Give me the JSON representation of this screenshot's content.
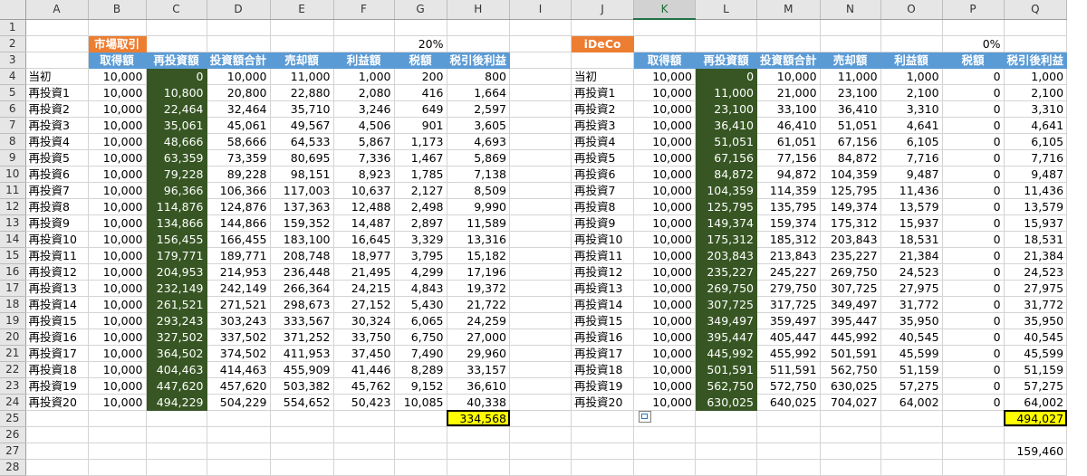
{
  "columns": [
    "A",
    "B",
    "C",
    "D",
    "E",
    "F",
    "G",
    "H",
    "I",
    "J",
    "K",
    "L",
    "M",
    "N",
    "O",
    "P",
    "Q"
  ],
  "selected_column": "K",
  "left": {
    "tag": "市場取引",
    "tax_rate": "20%",
    "headers": [
      "取得額",
      "再投資額",
      "投資額合計",
      "売却額",
      "利益額",
      "税額",
      "税引後利益"
    ],
    "rows": [
      [
        "当初",
        "10,000",
        "0",
        "10,000",
        "11,000",
        "1,000",
        "200",
        "800"
      ],
      [
        "再投資1",
        "10,000",
        "10,800",
        "20,800",
        "22,880",
        "2,080",
        "416",
        "1,664"
      ],
      [
        "再投資2",
        "10,000",
        "22,464",
        "32,464",
        "35,710",
        "3,246",
        "649",
        "2,597"
      ],
      [
        "再投資3",
        "10,000",
        "35,061",
        "45,061",
        "49,567",
        "4,506",
        "901",
        "3,605"
      ],
      [
        "再投資4",
        "10,000",
        "48,666",
        "58,666",
        "64,533",
        "5,867",
        "1,173",
        "4,693"
      ],
      [
        "再投資5",
        "10,000",
        "63,359",
        "73,359",
        "80,695",
        "7,336",
        "1,467",
        "5,869"
      ],
      [
        "再投資6",
        "10,000",
        "79,228",
        "89,228",
        "98,151",
        "8,923",
        "1,785",
        "7,138"
      ],
      [
        "再投資7",
        "10,000",
        "96,366",
        "106,366",
        "117,003",
        "10,637",
        "2,127",
        "8,509"
      ],
      [
        "再投資8",
        "10,000",
        "114,876",
        "124,876",
        "137,363",
        "12,488",
        "2,498",
        "9,990"
      ],
      [
        "再投資9",
        "10,000",
        "134,866",
        "144,866",
        "159,352",
        "14,487",
        "2,897",
        "11,589"
      ],
      [
        "再投資10",
        "10,000",
        "156,455",
        "166,455",
        "183,100",
        "16,645",
        "3,329",
        "13,316"
      ],
      [
        "再投資11",
        "10,000",
        "179,771",
        "189,771",
        "208,748",
        "18,977",
        "3,795",
        "15,182"
      ],
      [
        "再投資12",
        "10,000",
        "204,953",
        "214,953",
        "236,448",
        "21,495",
        "4,299",
        "17,196"
      ],
      [
        "再投資13",
        "10,000",
        "232,149",
        "242,149",
        "266,364",
        "24,215",
        "4,843",
        "19,372"
      ],
      [
        "再投資14",
        "10,000",
        "261,521",
        "271,521",
        "298,673",
        "27,152",
        "5,430",
        "21,722"
      ],
      [
        "再投資15",
        "10,000",
        "293,243",
        "303,243",
        "333,567",
        "30,324",
        "6,065",
        "24,259"
      ],
      [
        "再投資16",
        "10,000",
        "327,502",
        "337,502",
        "371,252",
        "33,750",
        "6,750",
        "27,000"
      ],
      [
        "再投資17",
        "10,000",
        "364,502",
        "374,502",
        "411,953",
        "37,450",
        "7,490",
        "29,960"
      ],
      [
        "再投資18",
        "10,000",
        "404,463",
        "414,463",
        "455,909",
        "41,446",
        "8,289",
        "33,157"
      ],
      [
        "再投資19",
        "10,000",
        "447,620",
        "457,620",
        "503,382",
        "45,762",
        "9,152",
        "36,610"
      ],
      [
        "再投資20",
        "10,000",
        "494,229",
        "504,229",
        "554,652",
        "50,423",
        "10,085",
        "40,338"
      ]
    ],
    "total": "334,568"
  },
  "right": {
    "tag": "iDeCo",
    "tax_rate": "0%",
    "headers": [
      "取得額",
      "再投資額",
      "投資額合計",
      "売却額",
      "利益額",
      "税額",
      "税引後利益"
    ],
    "rows": [
      [
        "当初",
        "10,000",
        "0",
        "10,000",
        "11,000",
        "1,000",
        "0",
        "1,000"
      ],
      [
        "再投資1",
        "10,000",
        "11,000",
        "21,000",
        "23,100",
        "2,100",
        "0",
        "2,100"
      ],
      [
        "再投資2",
        "10,000",
        "23,100",
        "33,100",
        "36,410",
        "3,310",
        "0",
        "3,310"
      ],
      [
        "再投資3",
        "10,000",
        "36,410",
        "46,410",
        "51,051",
        "4,641",
        "0",
        "4,641"
      ],
      [
        "再投資4",
        "10,000",
        "51,051",
        "61,051",
        "67,156",
        "6,105",
        "0",
        "6,105"
      ],
      [
        "再投資5",
        "10,000",
        "67,156",
        "77,156",
        "84,872",
        "7,716",
        "0",
        "7,716"
      ],
      [
        "再投資6",
        "10,000",
        "84,872",
        "94,872",
        "104,359",
        "9,487",
        "0",
        "9,487"
      ],
      [
        "再投資7",
        "10,000",
        "104,359",
        "114,359",
        "125,795",
        "11,436",
        "0",
        "11,436"
      ],
      [
        "再投資8",
        "10,000",
        "125,795",
        "135,795",
        "149,374",
        "13,579",
        "0",
        "13,579"
      ],
      [
        "再投資9",
        "10,000",
        "149,374",
        "159,374",
        "175,312",
        "15,937",
        "0",
        "15,937"
      ],
      [
        "再投資10",
        "10,000",
        "175,312",
        "185,312",
        "203,843",
        "18,531",
        "0",
        "18,531"
      ],
      [
        "再投資11",
        "10,000",
        "203,843",
        "213,843",
        "235,227",
        "21,384",
        "0",
        "21,384"
      ],
      [
        "再投資12",
        "10,000",
        "235,227",
        "245,227",
        "269,750",
        "24,523",
        "0",
        "24,523"
      ],
      [
        "再投資13",
        "10,000",
        "269,750",
        "279,750",
        "307,725",
        "27,975",
        "0",
        "27,975"
      ],
      [
        "再投資14",
        "10,000",
        "307,725",
        "317,725",
        "349,497",
        "31,772",
        "0",
        "31,772"
      ],
      [
        "再投資15",
        "10,000",
        "349,497",
        "359,497",
        "395,447",
        "35,950",
        "0",
        "35,950"
      ],
      [
        "再投資16",
        "10,000",
        "395,447",
        "405,447",
        "445,992",
        "40,545",
        "0",
        "40,545"
      ],
      [
        "再投資17",
        "10,000",
        "445,992",
        "455,992",
        "501,591",
        "45,599",
        "0",
        "45,599"
      ],
      [
        "再投資18",
        "10,000",
        "501,591",
        "511,591",
        "562,750",
        "51,159",
        "0",
        "51,159"
      ],
      [
        "再投資19",
        "10,000",
        "562,750",
        "572,750",
        "630,025",
        "57,275",
        "0",
        "57,275"
      ],
      [
        "再投資20",
        "10,000",
        "630,025",
        "640,025",
        "704,027",
        "64,002",
        "0",
        "64,002"
      ]
    ],
    "total": "494,027",
    "difference": "159,460"
  },
  "icons": {
    "paste_options": "paste-options-icon"
  }
}
